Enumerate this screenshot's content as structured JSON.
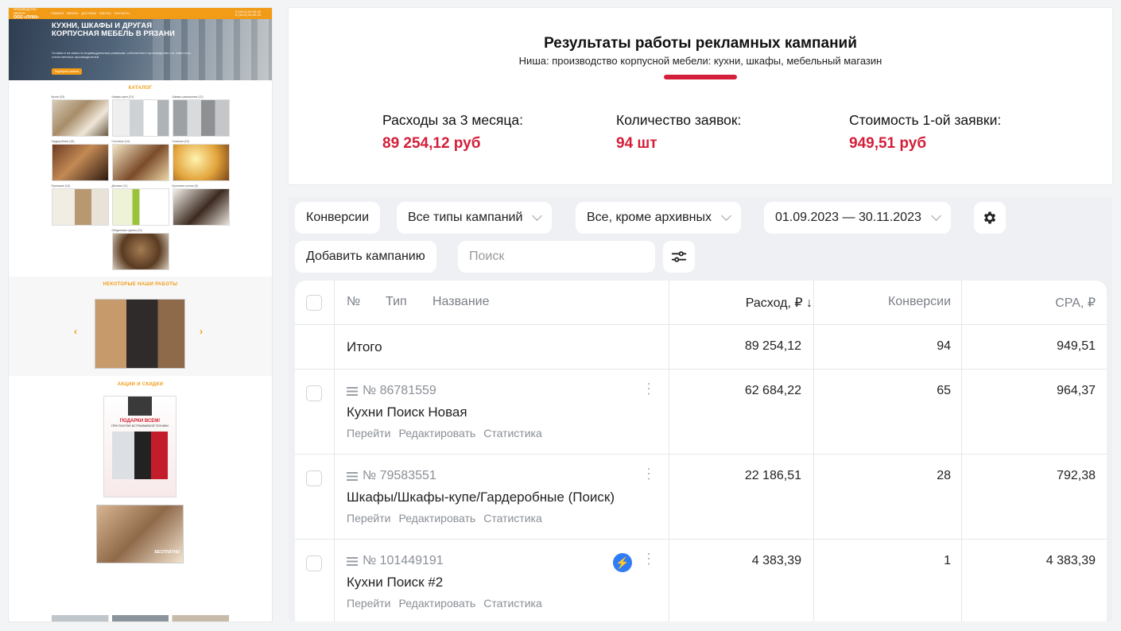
{
  "site": {
    "topbar": {
      "logo_line1": "ПРОИЗВОДСТВО МЕБЕЛИ",
      "logo_line2": "ООО «ЛУКИ»",
      "nav": [
        "ГЛАВНАЯ",
        "МЕБЕЛЬ",
        "ДОСТАВКА",
        "РАБОТЫ",
        "КОНТАКТЫ"
      ],
      "phone1": "8 (4912) 00-00-00",
      "phone2": "8 (4912) 00-00-00"
    },
    "hero": {
      "title": "КУХНИ, ШКАФЫ И ДРУГАЯ КОРПУСНАЯ МЕБЕЛЬ В РЯЗАНИ",
      "subtitle": "Готовая и на заказ по индивидуальным размерам, собственного производства и от известных отечественных производителей.",
      "button": "Подобрать мебель"
    },
    "catalog_title": "КАТАЛОГ",
    "catalog_items": [
      {
        "label": "Кухни (33)",
        "tone": "k1"
      },
      {
        "label": "Шкафы-купе (21)",
        "tone": "k2"
      },
      {
        "label": "Шкафы распашные (12)",
        "tone": "k3"
      },
      {
        "label": "Гардеробные (18)",
        "tone": "k4"
      },
      {
        "label": "Гостиные (14)",
        "tone": "k5"
      },
      {
        "label": "Спальни (10)",
        "tone": "k6"
      },
      {
        "label": "Прихожие (15)",
        "tone": "k7"
      },
      {
        "label": "Детские (11)",
        "tone": "k8"
      },
      {
        "label": "Кухонные уголки (9)",
        "tone": "k9"
      },
      {
        "label": "Обеденные группы (14)",
        "tone": "k10"
      }
    ],
    "works_title": "НЕКОТОРЫЕ НАШИ РАБОТЫ",
    "promo_title": "АКЦИИ И СКИДКИ",
    "promo1": {
      "title": "ПОДАРКИ ВСЕМ!",
      "subtitle": "ПРИ ПОКУПКЕ ВСТРАИВАЕМОЙ ТЕХНИКИ"
    },
    "promo2": {
      "title": "БЕСПЛАТНО"
    }
  },
  "results": {
    "title": "Результаты работы рекламных кампаний",
    "subtitle": "Ниша: производство корпусной мебели: кухни, шкафы, мебельный магазин",
    "accent_color": "#d41f3a",
    "metrics": [
      {
        "label": "Расходы за 3 месяца:",
        "value": "89 254,12 руб"
      },
      {
        "label": "Количество заявок:",
        "value": "94 шт"
      },
      {
        "label": "Стоимость 1-ой заявки:",
        "value": "949,51 руб"
      }
    ]
  },
  "direct": {
    "toolbar": {
      "conversions": "Конверсии",
      "campaign_types": "Все типы кампаний",
      "archive_filter": "Все, кроме архивных",
      "date_range": "01.09.2023 — 30.11.2023",
      "settings_icon": "gear-icon",
      "add_campaign": "Добавить кампанию",
      "search_placeholder": "Поиск",
      "filter_icon": "sliders-icon"
    },
    "table": {
      "headers": {
        "no": "№",
        "type": "Тип",
        "name": "Название",
        "spend": "Расход, ₽ ↓",
        "conversions": "Конверсии",
        "cpa": "CPA, ₽"
      },
      "total": {
        "label": "Итого",
        "spend": "89 254,12",
        "conversions": "94",
        "cpa": "949,51"
      },
      "rows": [
        {
          "id": "№ 86781559",
          "name": "Кухни Поиск Новая",
          "spend": "62 684,22",
          "conversions": "65",
          "cpa": "964,37",
          "bolt": false
        },
        {
          "id": "№ 79583551",
          "name": "Шкафы/Шкафы-купе/Гардеробные (Поиск)",
          "spend": "22 186,51",
          "conversions": "28",
          "cpa": "792,38",
          "bolt": false
        },
        {
          "id": "№ 101449191",
          "name": "Кухни Поиск #2",
          "spend": "4 383,39",
          "conversions": "1",
          "cpa": "4 383,39",
          "bolt": true
        }
      ],
      "row_links": [
        "Перейти",
        "Редактировать",
        "Статистика"
      ]
    }
  }
}
